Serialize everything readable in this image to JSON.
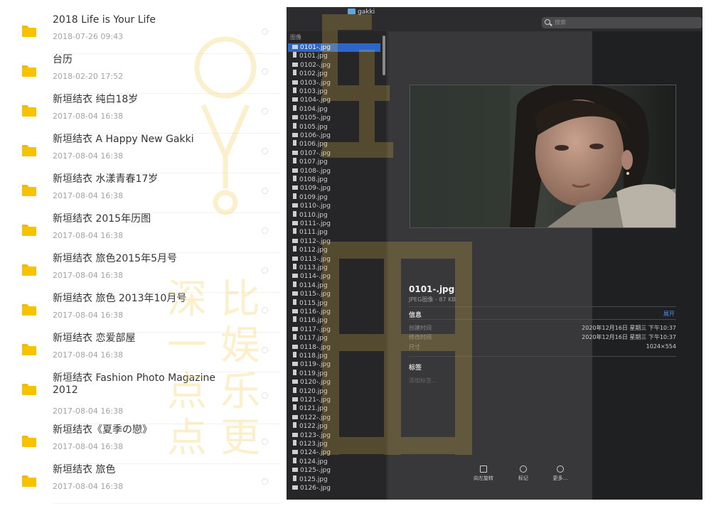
{
  "folders": [
    {
      "title": "2018 Life is Your Life",
      "date": "2018-07-26 09:43"
    },
    {
      "title": "台历",
      "date": "2018-02-20 17:52"
    },
    {
      "title": "新垣结衣 纯白18岁",
      "date": "2017-08-04 16:38"
    },
    {
      "title": "新垣结衣 A Happy New Gakki",
      "date": "2017-08-04 16:38"
    },
    {
      "title": "新垣结衣 水漾青春17岁",
      "date": "2017-08-04 16:38"
    },
    {
      "title": "新垣结衣 2015年历图",
      "date": "2017-08-04 16:38"
    },
    {
      "title": "新垣结衣 旅色2015年5月号",
      "date": "2017-08-04 16:38"
    },
    {
      "title": "新垣结衣 旅色 2013年10月号",
      "date": "2017-08-04 16:38"
    },
    {
      "title": "新垣结衣 恋爱部屋",
      "date": "2017-08-04 16:38"
    },
    {
      "title": "新垣结衣 Fashion Photo Magazine 2012",
      "date": "2017-08-04 16:38"
    },
    {
      "title": "新垣结衣《夏季の戀》",
      "date": "2017-08-04 16:38"
    },
    {
      "title": "新垣结衣 旅色",
      "date": "2017-08-04 16:38"
    }
  ],
  "finder": {
    "window_title": "gakki",
    "search_placeholder": "搜索",
    "column_header": "图像",
    "files": [
      "0101-.jpg",
      "0101.jpg",
      "0102-.jpg",
      "0102.jpg",
      "0103-.jpg",
      "0103.jpg",
      "0104-.jpg",
      "0104.jpg",
      "0105-.jpg",
      "0105.jpg",
      "0106-.jpg",
      "0106.jpg",
      "0107-.jpg",
      "0107.jpg",
      "0108-.jpg",
      "0108.jpg",
      "0109-.jpg",
      "0109.jpg",
      "0110-.jpg",
      "0110.jpg",
      "0111-.jpg",
      "0111.jpg",
      "0112-.jpg",
      "0112.jpg",
      "0113-.jpg",
      "0113.jpg",
      "0114-.jpg",
      "0114.jpg",
      "0115-.jpg",
      "0115.jpg",
      "0116-.jpg",
      "0116.jpg",
      "0117-.jpg",
      "0117.jpg",
      "0118-.jpg",
      "0118.jpg",
      "0119-.jpg",
      "0119.jpg",
      "0120-.jpg",
      "0120.jpg",
      "0121-.jpg",
      "0121.jpg",
      "0122-.jpg",
      "0122.jpg",
      "0123-.jpg",
      "0123.jpg",
      "0124-.jpg",
      "0124.jpg",
      "0125-.jpg",
      "0125.jpg",
      "0126-.jpg"
    ],
    "selected_file": "0101-.jpg",
    "preview": {
      "name": "0101-.jpg",
      "subtitle": "JPEG图像 - 87 KB",
      "info_header": "信息",
      "expand_label": "展开",
      "created_label": "创建时间",
      "created_value": "2020年12月16日 星期三 下午10:37",
      "modified_label": "修改时间",
      "modified_value": "2020年12月16日 星期三 下午10:37",
      "size_label": "尺寸",
      "size_value": "1024×554",
      "tags_header": "标签",
      "add_tag": "添加标签…"
    },
    "tools": {
      "rotate": "向左旋转",
      "markup": "标记",
      "more": "更多…"
    }
  },
  "watermark": {
    "chars": [
      "深",
      "比",
      "一",
      "娱",
      "点",
      "乐",
      "点",
      "更"
    ]
  },
  "colors": {
    "folder": "#f7c300",
    "selection": "#2c66c8",
    "accent": "#4b8ff0",
    "watermark": "#f2c84b"
  }
}
